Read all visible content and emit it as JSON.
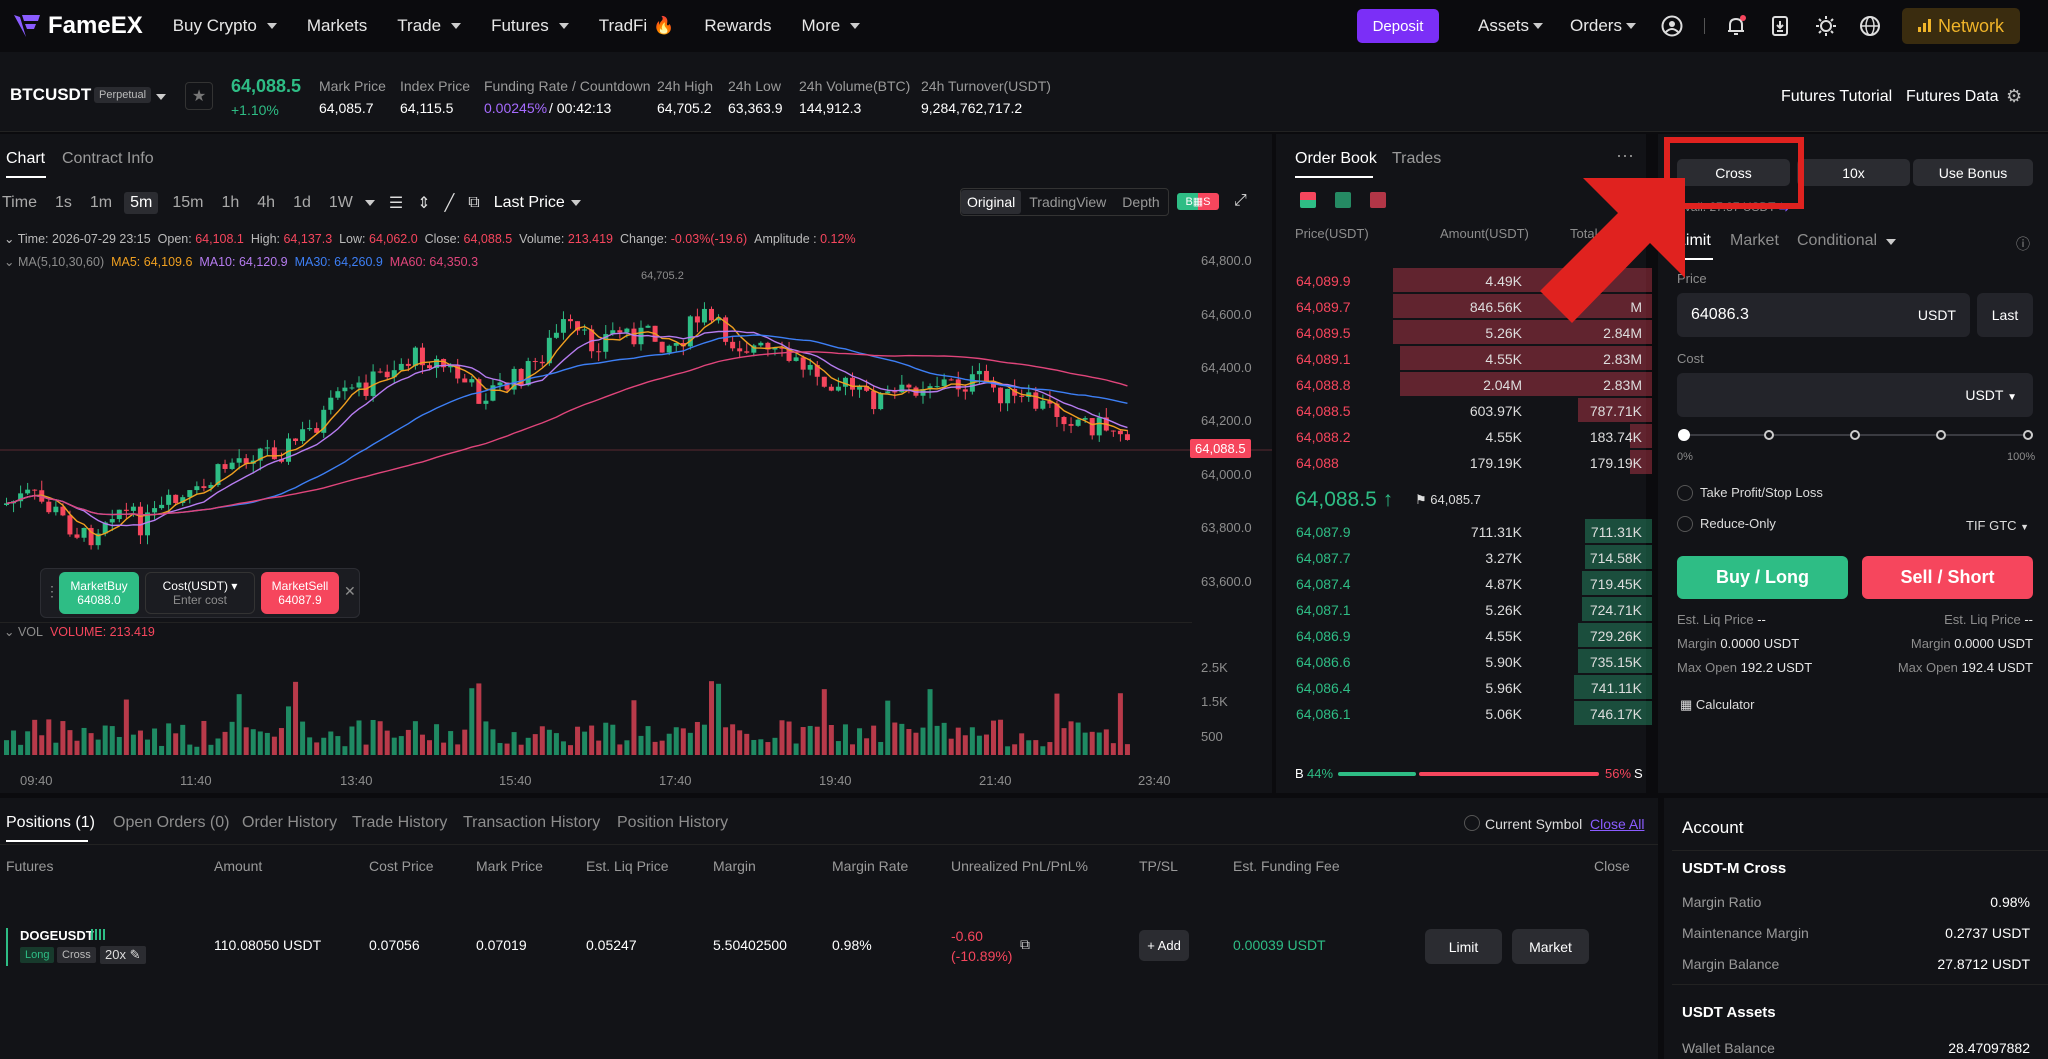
{
  "nav": {
    "brand": "FameEX",
    "items": [
      "Buy Crypto",
      "Markets",
      "Trade",
      "Futures",
      "TradFi",
      "Rewards",
      "More"
    ],
    "deposit": "Deposit",
    "assets": "Assets",
    "orders": "Orders",
    "network": "Network"
  },
  "ticker": {
    "symbol": "BTCUSDT",
    "type": "Perpetual",
    "price": "64,088.5",
    "change": "+1.10%",
    "stats": [
      {
        "label": "Mark Price",
        "value": "64,085.7"
      },
      {
        "label": "Index Price",
        "value": "64,115.5"
      },
      {
        "label": "Funding Rate / Countdown",
        "value": "0.00245%",
        "value2": "/ 00:42:13"
      },
      {
        "label": "24h High",
        "value": "64,705.2"
      },
      {
        "label": "24h Low",
        "value": "63,363.9"
      },
      {
        "label": "24h Volume(BTC)",
        "value": "144,912.3"
      },
      {
        "label": "24h Turnover(USDT)",
        "value": "9,284,762,717.2"
      }
    ],
    "tutorial": "Futures Tutorial",
    "data": "Futures Data"
  },
  "chart": {
    "tabs": [
      "Chart",
      "Contract Info"
    ],
    "intervals": [
      "Time",
      "1s",
      "1m",
      "5m",
      "15m",
      "1h",
      "4h",
      "1d",
      "1W"
    ],
    "active_interval": "5m",
    "price_type": "Last Price",
    "views": [
      "Original",
      "TradingView",
      "Depth"
    ],
    "info": {
      "time": "Time: 2026-07-29 23:15",
      "open_l": "Open:",
      "open": "64,108.1",
      "high_l": "High:",
      "high": "64,137.3",
      "low_l": "Low:",
      "low": "64,062.0",
      "close_l": "Close:",
      "close": "64,088.5",
      "volume_l": "Volume:",
      "volume": "213.419",
      "change_l": "Change:",
      "change": "-0.03%(-19.6)",
      "amp_l": "Amplitude :",
      "amp": "0.12%"
    },
    "ma": {
      "label": "MA(5,10,30,60)",
      "ma5": "MA5: 64,109.6",
      "ma10": "MA10: 64,120.9",
      "ma30": "MA30: 64,260.9",
      "ma60": "MA60: 64,350.3"
    },
    "price_axis": [
      "64,800.0",
      "64,600.0",
      "64,400.0",
      "64,200.0",
      "64,000.0",
      "63,800.0",
      "63,600.0"
    ],
    "last_tag": "64,088.5",
    "high_mark": "64,705.2",
    "vol_label": "VOL",
    "vol_value": "VOLUME: 213.419",
    "vol_axis": [
      "2.5K",
      "1.5K",
      "500"
    ],
    "time_axis": [
      "09:40",
      "11:40",
      "13:40",
      "15:40",
      "17:40",
      "19:40",
      "21:40",
      "23:40"
    ],
    "quick": {
      "buy": "MarketBuy",
      "buy_price": "64088.0",
      "cost": "Cost(USDT)",
      "cost_ph": "Enter cost",
      "sell": "MarketSell",
      "sell_price": "64087.9"
    }
  },
  "orderbook": {
    "tabs": [
      "Order Book",
      "Trades"
    ],
    "headers": [
      "Price(USDT)",
      "Amount(USDT)",
      "Total"
    ],
    "asks": [
      [
        "64,089.9",
        "4.49K",
        ""
      ],
      [
        "64,089.7",
        "846.56K",
        "M"
      ],
      [
        "64,089.5",
        "5.26K",
        "2.84M"
      ],
      [
        "64,089.1",
        "4.55K",
        "2.83M"
      ],
      [
        "64,088.8",
        "2.04M",
        "2.83M"
      ],
      [
        "64,088.5",
        "603.97K",
        "787.71K"
      ],
      [
        "64,088.2",
        "4.55K",
        "183.74K"
      ],
      [
        "64,088",
        "179.19K",
        "179.19K"
      ]
    ],
    "mid": "64,088.5",
    "mid_mark": "64,085.7",
    "bids": [
      [
        "64,087.9",
        "711.31K",
        "711.31K"
      ],
      [
        "64,087.7",
        "3.27K",
        "714.58K"
      ],
      [
        "64,087.4",
        "4.87K",
        "719.45K"
      ],
      [
        "64,087.1",
        "5.26K",
        "724.71K"
      ],
      [
        "64,086.9",
        "4.55K",
        "729.26K"
      ],
      [
        "64,086.6",
        "5.90K",
        "735.15K"
      ],
      [
        "64,086.4",
        "5.96K",
        "741.11K"
      ],
      [
        "64,086.1",
        "5.06K",
        "746.17K"
      ]
    ],
    "b_label": "B",
    "b_pct": "44%",
    "s_pct": "56%",
    "s_label": "S"
  },
  "order": {
    "margin_mode": "Cross",
    "leverage": "10x",
    "bonus": "Use Bonus",
    "types": [
      "Limit",
      "Market",
      "Conditional"
    ],
    "price_label": "Price",
    "price": "64086.3",
    "unit": "USDT",
    "last": "Last",
    "cost_label": "Cost",
    "cost_unit": "USDT",
    "slider_min": "0%",
    "slider_max": "100%",
    "tpsl": "Take Profit/Stop Loss",
    "reduce": "Reduce-Only",
    "tif": "TIF GTC",
    "buy": "Buy / Long",
    "sell": "Sell / Short",
    "liq_l": "Est. Liq Price",
    "liq_v": "--",
    "margin_l": "Margin",
    "margin_v": "0.0000 USDT",
    "max_l": "Max Open",
    "max_buy": "192.2 USDT",
    "max_sell": "192.4 USDT",
    "calc": "Calculator",
    "avail": "Avail. 27.87 USDT"
  },
  "positions": {
    "tabs": [
      "Positions (1)",
      "Open Orders (0)",
      "Order History",
      "Trade History",
      "Transaction History",
      "Position History"
    ],
    "current_symbol": "Current Symbol",
    "close_all": "Close All",
    "headers": [
      "Futures",
      "Amount",
      "Cost Price",
      "Mark Price",
      "Est. Liq Price",
      "Margin",
      "Margin Rate",
      "Unrealized PnL/PnL%",
      "TP/SL",
      "Est. Funding Fee",
      "Close"
    ],
    "row": {
      "symbol": "DOGEUSDT",
      "side": "Long",
      "mode": "Cross",
      "lev": "20x",
      "amount": "110.08050 USDT",
      "cost": "0.07056",
      "mark": "0.07019",
      "liq": "0.05247",
      "margin": "5.50402500",
      "rate": "0.98%",
      "pnl": "-0.60",
      "pnl_pct": "(-10.89%)",
      "add": "+ Add",
      "fee": "0.00039 USDT",
      "limit": "Limit",
      "market": "Market"
    }
  },
  "account": {
    "title": "Account",
    "section": "USDT-M Cross",
    "rows": [
      [
        "Margin Ratio",
        "0.98%"
      ],
      [
        "Maintenance Margin",
        "0.2737 USDT"
      ],
      [
        "Margin Balance",
        "27.8712 USDT"
      ]
    ],
    "assets": "USDT Assets",
    "wallet_l": "Wallet Balance",
    "wallet_v": "28.47097882"
  },
  "colors": {
    "up": "#2ebd85",
    "down": "#f6465d",
    "accent": "#7b2ff7",
    "annotation": "#e0221f"
  }
}
